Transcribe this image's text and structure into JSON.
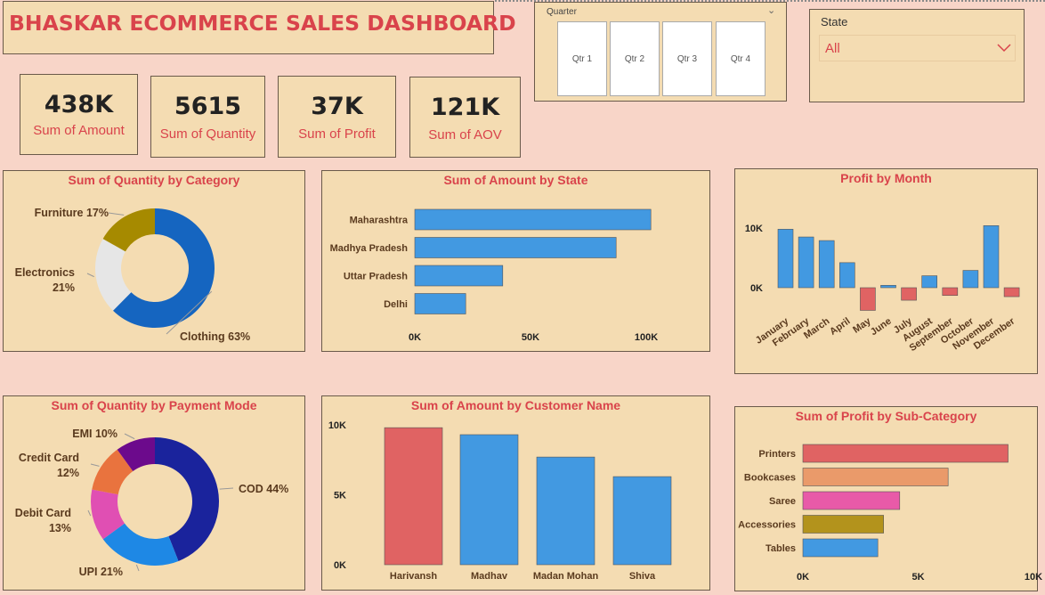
{
  "header": {
    "title": "BHASKAR ECOMMERCE SALES DASHBOARD"
  },
  "kpis": [
    {
      "value": "438K",
      "label": "Sum of Amount"
    },
    {
      "value": "5615",
      "label": "Sum of Quantity"
    },
    {
      "value": "37K",
      "label": "Sum of Profit"
    },
    {
      "value": "121K",
      "label": "Sum of AOV"
    }
  ],
  "quarter_slicer": {
    "label": "Quarter",
    "options": [
      "Qtr 1",
      "Qtr 2",
      "Qtr 3",
      "Qtr 4"
    ]
  },
  "state_slicer": {
    "label": "State",
    "value": "All"
  },
  "colors": {
    "blue": "#4299e1",
    "red": "#e06363",
    "accent": "#d9434b",
    "panel": "#f4dcb2",
    "background": "#f8d5c8"
  },
  "chart_data": [
    {
      "id": "qty_by_category",
      "type": "pie",
      "title": "Sum of Quantity by Category",
      "slices": [
        {
          "label": "Clothing",
          "pct_label": "63%",
          "value": 63,
          "color": "#1565c0"
        },
        {
          "label": "Electronics",
          "pct_label": "21%",
          "value": 21,
          "color": "#e6e6e6"
        },
        {
          "label": "Furniture",
          "pct_label": "17%",
          "value": 17,
          "color": "#a68a00"
        }
      ]
    },
    {
      "id": "amount_by_state",
      "type": "bar",
      "orientation": "horizontal",
      "title": "Sum of Amount by State",
      "categories": [
        "Maharashtra",
        "Madhya Pradesh",
        "Uttar Pradesh",
        "Delhi"
      ],
      "values": [
        102000,
        87000,
        38000,
        22000
      ],
      "xlim": [
        0,
        100000
      ],
      "xticks": [
        "0K",
        "50K",
        "100K"
      ],
      "color": "#4299e1"
    },
    {
      "id": "profit_by_month",
      "type": "bar",
      "title": "Profit by Month",
      "categories": [
        "January",
        "February",
        "March",
        "April",
        "May",
        "June",
        "July",
        "August",
        "September",
        "October",
        "November",
        "December"
      ],
      "values": [
        9800,
        8500,
        7900,
        4200,
        -3800,
        400,
        -2100,
        2000,
        -1300,
        2900,
        10400,
        -1500
      ],
      "ylim": [
        -4000,
        11000
      ],
      "yticks": [
        {
          "label": "10K",
          "value": 10000
        },
        {
          "label": "0K",
          "value": 0
        }
      ],
      "pos_color": "#4299e1",
      "neg_color": "#e06363"
    },
    {
      "id": "qty_by_payment",
      "type": "pie",
      "title": "Sum of Quantity by Payment Mode",
      "slices": [
        {
          "label": "COD",
          "pct_label": "44%",
          "value": 44,
          "color": "#1a239c"
        },
        {
          "label": "UPI",
          "pct_label": "21%",
          "value": 21,
          "color": "#1e88e5"
        },
        {
          "label": "Debit Card",
          "pct_label": "13%",
          "value": 13,
          "color": "#e04fb3"
        },
        {
          "label": "Credit Card",
          "pct_label": "12%",
          "value": 12,
          "color": "#e9733e"
        },
        {
          "label": "EMI",
          "pct_label": "10%",
          "value": 10,
          "color": "#6c0a8c"
        }
      ]
    },
    {
      "id": "amount_by_customer",
      "type": "bar",
      "title": "Sum of Amount by Customer Name",
      "categories": [
        "Harivansh",
        "Madhav",
        "Madan Mohan",
        "Shiva"
      ],
      "values": [
        9800,
        9300,
        7700,
        6300
      ],
      "ylim": [
        0,
        10000
      ],
      "yticks": [
        {
          "label": "10K",
          "value": 10000
        },
        {
          "label": "5K",
          "value": 5000
        },
        {
          "label": "0K",
          "value": 0
        }
      ],
      "colors": [
        "#e06363",
        "#4299e1",
        "#4299e1",
        "#4299e1"
      ]
    },
    {
      "id": "profit_by_subcategory",
      "type": "bar",
      "orientation": "horizontal",
      "title": "Sum of Profit by Sub-Category",
      "categories": [
        "Printers",
        "Bookcases",
        "Saree",
        "Accessories",
        "Tables"
      ],
      "values": [
        8900,
        6300,
        4200,
        3500,
        3250
      ],
      "xlim": [
        0,
        10000
      ],
      "xticks": [
        "0K",
        "5K",
        "10K"
      ],
      "colors": [
        "#e06363",
        "#ea9a6a",
        "#e85aa8",
        "#b3931c",
        "#4299e1"
      ]
    }
  ]
}
